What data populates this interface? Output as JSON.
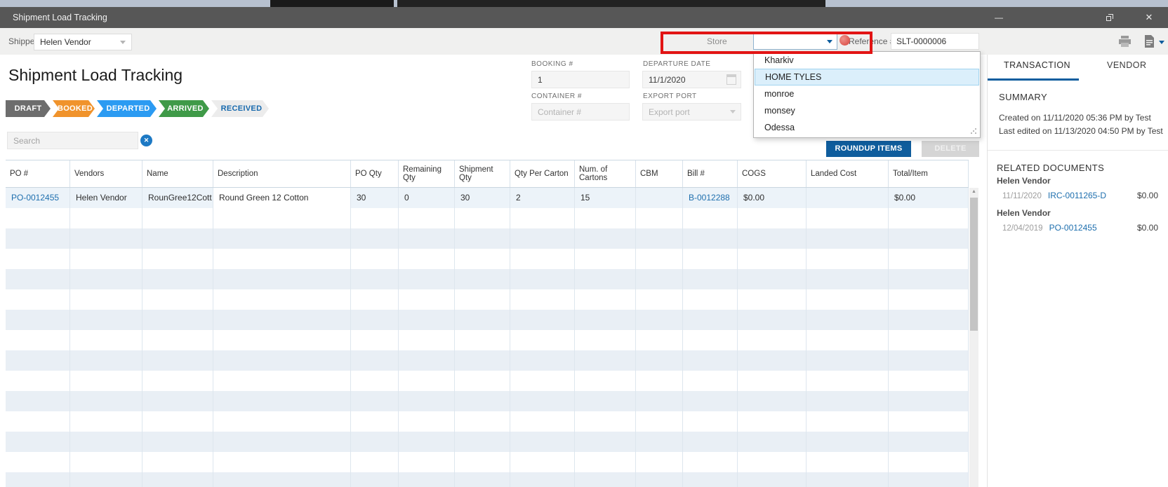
{
  "window": {
    "title": "Shipment Load Tracking",
    "controls": {
      "minimize": "minimize",
      "restore": "restore",
      "close": "close"
    }
  },
  "toolbar": {
    "shipper_label": "Shipper:",
    "shipper_value": "Helen Vendor",
    "store_label": "Store",
    "store_value": "",
    "reference_label": "Reference #:",
    "reference_value": "SLT-0000006"
  },
  "store_dropdown": {
    "items": [
      "Kharkiv",
      "HOME TYLES",
      "monroe",
      "monsey",
      "Odessa"
    ],
    "selected": "HOME TYLES"
  },
  "page": {
    "title": "Shipment Load Tracking"
  },
  "statuses": [
    {
      "label": "DRAFT",
      "bg": "#6d6d6d",
      "fg": "#ffffff"
    },
    {
      "label": "BOOKED",
      "bg": "#f0932c",
      "fg": "#ffffff"
    },
    {
      "label": "DEPARTED",
      "bg": "#2b9bf2",
      "fg": "#ffffff"
    },
    {
      "label": "ARRIVED",
      "bg": "#3f9a48",
      "fg": "#ffffff"
    },
    {
      "label": "RECEIVED",
      "bg": "#ececec",
      "fg": "#1769ad"
    }
  ],
  "fields": {
    "booking_label": "BOOKING #",
    "booking_value": "1",
    "departure_label": "DEPARTURE DATE",
    "departure_value": "11/1/2020",
    "container_label": "CONTAINER #",
    "container_placeholder": "Container #",
    "export_label": "EXPORT PORT",
    "export_placeholder": "Export port"
  },
  "search": {
    "placeholder": "Search"
  },
  "buttons": {
    "roundup": "ROUNDUP ITEMS",
    "delete": "DELETE"
  },
  "table": {
    "columns": [
      "PO #",
      "Vendors",
      "Name",
      "Description",
      "PO Qty",
      "Remaining Qty",
      "Shipment Qty",
      "Qty Per Carton",
      "Num. of Cartons",
      "CBM",
      "Bill #",
      "COGS",
      "Landed Cost",
      "Total/Item"
    ],
    "link_columns": [
      0,
      10
    ],
    "highlight_column": 3,
    "rows": [
      {
        "cells": [
          "PO-0012455",
          "Helen Vendor",
          "RounGree12Cott",
          "Round Green 12 Cotton",
          "30",
          "0",
          "30",
          "2",
          "15",
          "",
          "B-0012288",
          "$0.00",
          "",
          "$0.00"
        ]
      }
    ],
    "empty_row_count": 14
  },
  "side_panel": {
    "tabs": [
      "TRANSACTION",
      "VENDOR"
    ],
    "summary_title": "SUMMARY",
    "created_line": "Created on 11/11/2020 05:36 PM by Test",
    "edited_line": "Last edited on 11/13/2020 04:50 PM by Test",
    "related_title": "RELATED DOCUMENTS",
    "documents": [
      {
        "vendor": "Helen Vendor",
        "date": "11/11/2020",
        "number": "IRC-0011265-D",
        "amount": "$0.00"
      },
      {
        "vendor": "Helen Vendor",
        "date": "12/04/2019",
        "number": "PO-0012455",
        "amount": "$0.00"
      }
    ]
  },
  "colors": {
    "accent_blue": "#0f5d9d",
    "link_blue": "#1e6fae",
    "annotation_red": "#e21414"
  }
}
